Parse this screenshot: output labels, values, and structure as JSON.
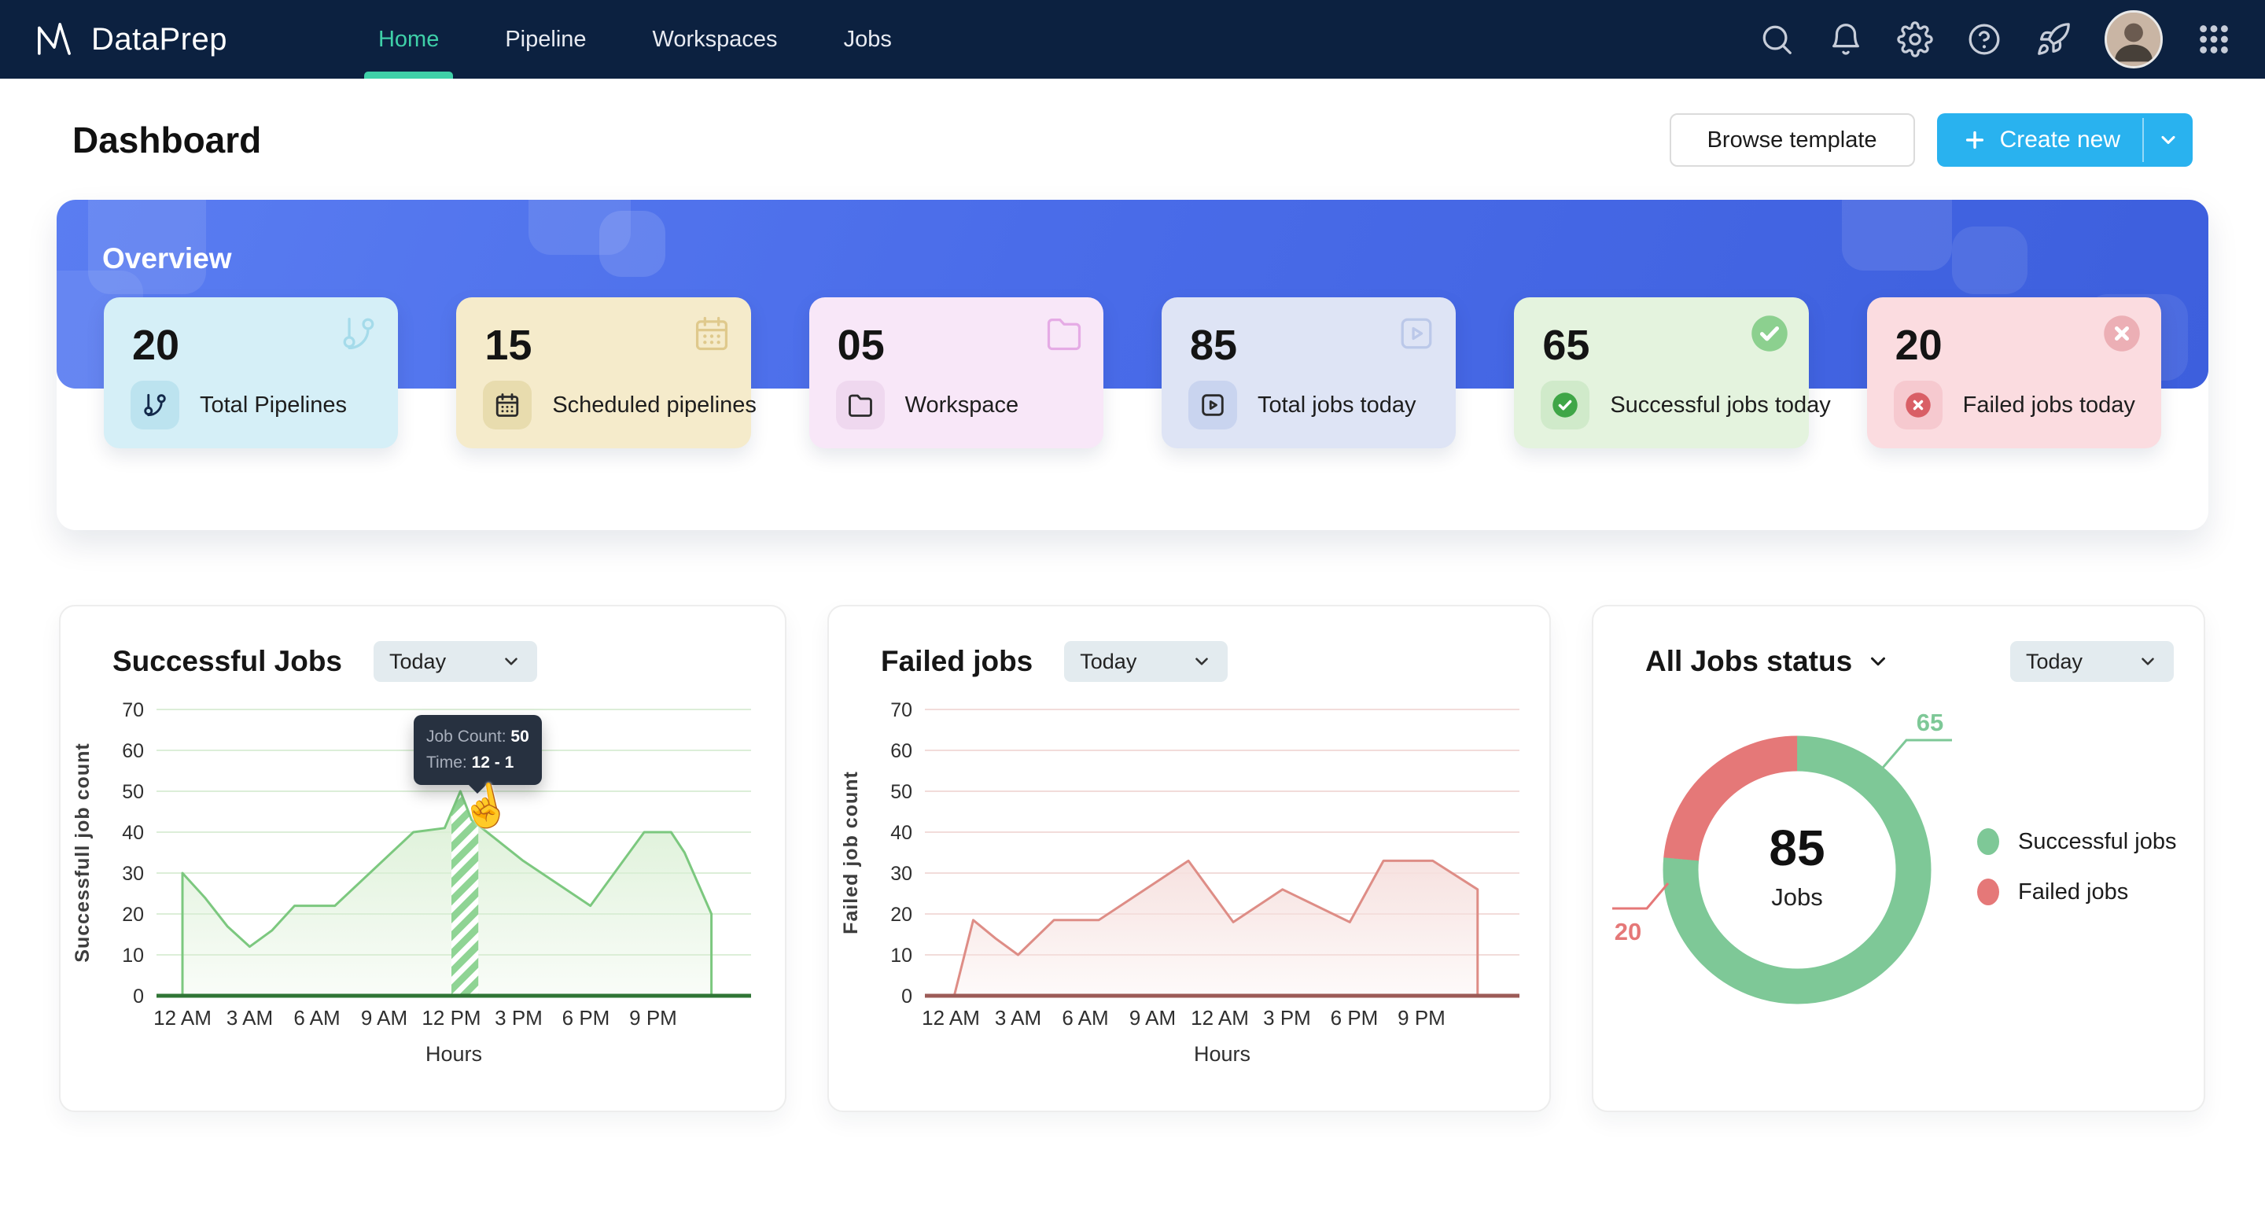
{
  "brand": {
    "name": "DataPrep"
  },
  "nav": {
    "items": [
      {
        "label": "Home",
        "active": true
      },
      {
        "label": "Pipeline",
        "active": false
      },
      {
        "label": "Workspaces",
        "active": false
      },
      {
        "label": "Jobs",
        "active": false
      }
    ],
    "icons": [
      {
        "name": "search"
      },
      {
        "name": "notifications"
      },
      {
        "name": "settings"
      },
      {
        "name": "help"
      },
      {
        "name": "launcher"
      },
      {
        "name": "user-avatar"
      },
      {
        "name": "apps-grid"
      }
    ]
  },
  "page": {
    "title": "Dashboard",
    "browse_button": "Browse template",
    "create_button": "Create new"
  },
  "overview": {
    "title": "Overview",
    "cards": [
      {
        "value": "20",
        "label": "Total Pipelines",
        "icon": "pipeline",
        "bg": "#D5EFF7",
        "badge_bg": "#BCE3EF",
        "icon_color": "#13294A",
        "accent": "#A5DBEA"
      },
      {
        "value": "15",
        "label": "Scheduled pipelines",
        "icon": "calendar",
        "bg": "#F5EBCB",
        "badge_bg": "#E8DCAE",
        "icon_color": "#2B2B2B",
        "accent": "#DFC98C"
      },
      {
        "value": "05",
        "label": "Workspace",
        "icon": "folder",
        "bg": "#F8E7F8",
        "badge_bg": "#EFD8EF",
        "icon_color": "#2B2B2B",
        "accent": "#E5ABE5"
      },
      {
        "value": "85",
        "label": "Total jobs today",
        "icon": "play",
        "bg": "#DEE4F5",
        "badge_bg": "#C9D4EF",
        "icon_color": "#2B2B2B",
        "accent": "#BBC8E9"
      },
      {
        "value": "65",
        "label": "Successful jobs today",
        "icon": "check",
        "bg": "#E4F3DE",
        "badge_bg": "#D0EACA",
        "icon_color": "#3FA647",
        "accent": "#8CD08F"
      },
      {
        "value": "20",
        "label": "Failed jobs today",
        "icon": "x",
        "bg": "#FBDCE0",
        "badge_bg": "#F6C9CF",
        "icon_color": "#D95F66",
        "accent": "#ECAFB5"
      }
    ]
  },
  "chart_data": [
    {
      "id": "successful",
      "type": "area",
      "title": "Successful Jobs",
      "filter": "Today",
      "xlabel": "Hours",
      "ylabel": "Successfull job count",
      "ylim": [
        0,
        70
      ],
      "y_ticks": [
        0,
        10,
        20,
        30,
        40,
        50,
        60,
        70
      ],
      "x_ticks": [
        "12 AM",
        "3 AM",
        "6 AM",
        "9 AM",
        "12 PM",
        "3 PM",
        "6 PM",
        "9 PM"
      ],
      "points": [
        [
          0,
          30
        ],
        [
          1,
          24
        ],
        [
          2,
          17
        ],
        [
          3,
          12
        ],
        [
          4,
          16
        ],
        [
          5,
          22
        ],
        [
          6.8,
          22
        ],
        [
          10.3,
          40
        ],
        [
          11.7,
          41
        ],
        [
          12.4,
          50
        ],
        [
          12.9,
          43
        ],
        [
          15.2,
          33
        ],
        [
          18.2,
          22
        ],
        [
          20.6,
          40
        ],
        [
          21.8,
          40
        ],
        [
          22.4,
          35
        ],
        [
          23.6,
          20
        ]
      ],
      "highlight": {
        "from": 12,
        "to": 13.2
      },
      "tooltip": {
        "label1": "Job Count:",
        "value1": "50",
        "label2": "Time:",
        "value2": "12 - 1"
      },
      "line_color": "#7CC87F",
      "fill_color": "#D9EFD3",
      "grid_color": "#DCEED8",
      "baseline_color": "#2F7535",
      "stripe_color": "#8FD494"
    },
    {
      "id": "failed",
      "type": "area",
      "title": "Failed jobs",
      "filter": "Today",
      "xlabel": "Hours",
      "ylabel": "Failed job count",
      "ylim": [
        0,
        70
      ],
      "y_ticks": [
        0,
        10,
        20,
        30,
        40,
        50,
        60,
        70
      ],
      "x_ticks": [
        "12 AM",
        "3 AM",
        "6 AM",
        "9 AM",
        "12 AM",
        "3 PM",
        "6 PM",
        "9 PM"
      ],
      "points": [
        [
          0.15,
          0
        ],
        [
          1,
          18.5
        ],
        [
          2,
          14
        ],
        [
          3,
          10
        ],
        [
          4.6,
          18.5
        ],
        [
          6.6,
          18.5
        ],
        [
          10.6,
          33
        ],
        [
          12.6,
          18
        ],
        [
          14.8,
          26
        ],
        [
          17.8,
          18
        ],
        [
          19.3,
          33
        ],
        [
          21.5,
          33
        ],
        [
          23.5,
          26
        ]
      ],
      "line_color": "#DE8D86",
      "fill_color": "#F6E0DE",
      "grid_color": "#F2DCDA",
      "baseline_color": "#9C5B57"
    },
    {
      "id": "all_jobs",
      "type": "donut",
      "title": "All Jobs status",
      "filter": "Today",
      "center_value": "85",
      "center_label": "Jobs",
      "slices": [
        {
          "label": "Successful jobs",
          "value": 65,
          "color": "#7EC897"
        },
        {
          "label": "Failed jobs",
          "value": 20,
          "color": "#E57878"
        }
      ]
    }
  ],
  "colors": {
    "nav_bg": "#0C2140",
    "accent_teal": "#3FD0A8",
    "banner_from": "#5A7DF1",
    "banner_to": "#3D5FDD",
    "create_blue": "#29B2EF"
  }
}
